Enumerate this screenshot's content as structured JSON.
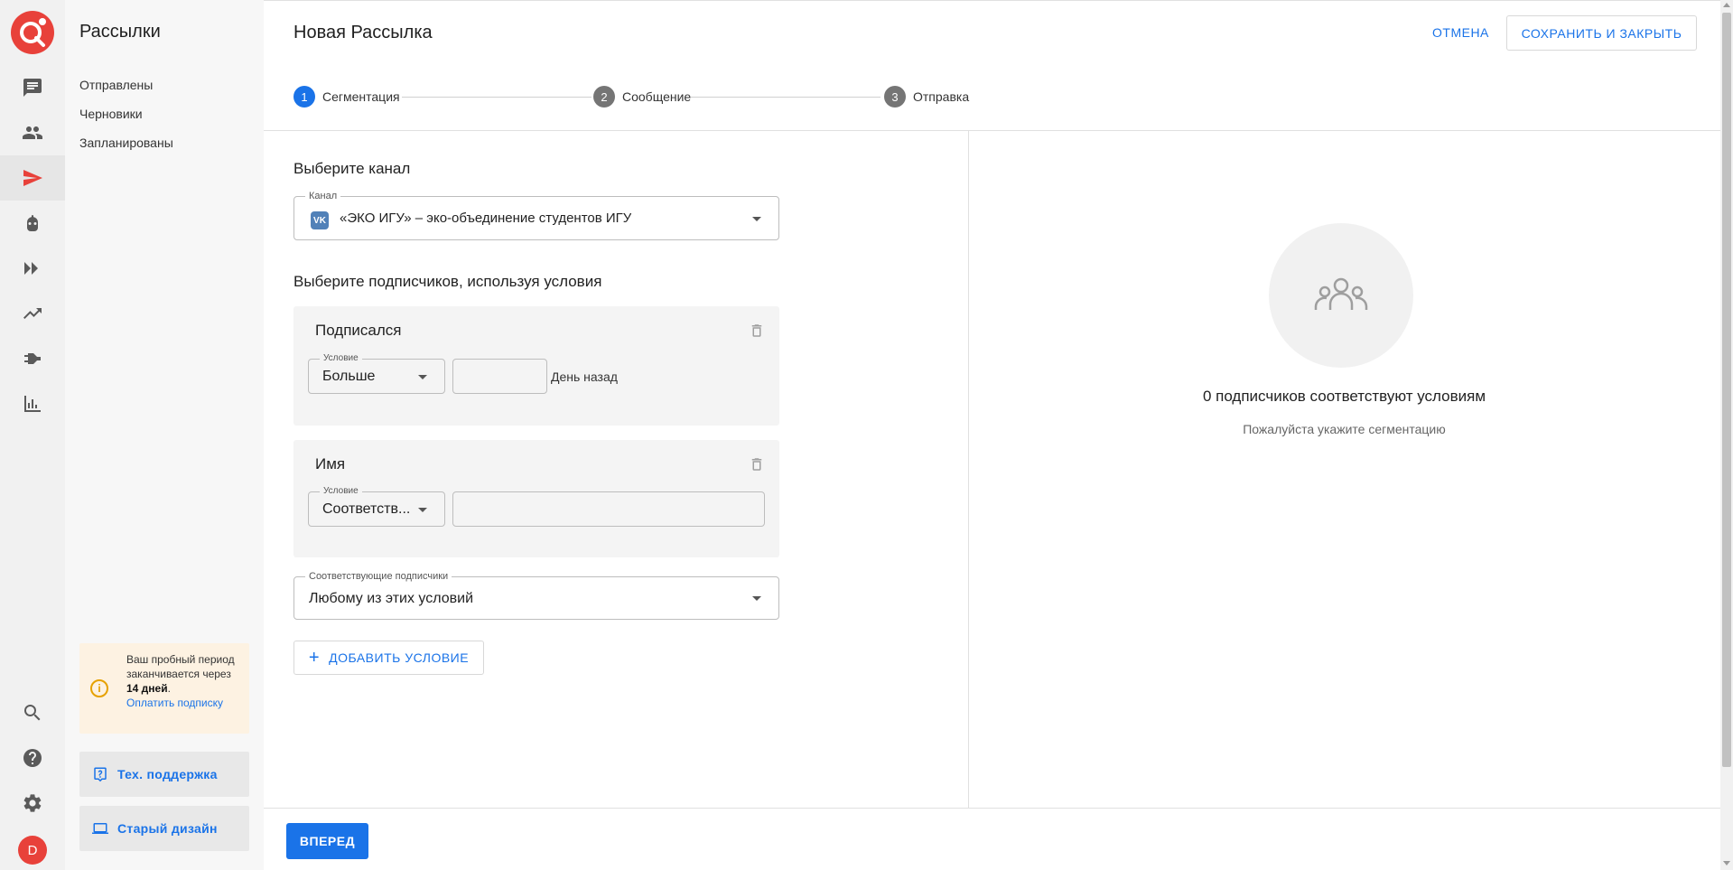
{
  "rail": {
    "items": [
      {
        "icon": "chat-icon",
        "active": false
      },
      {
        "icon": "people-icon",
        "active": false
      },
      {
        "icon": "send-icon",
        "active": true
      },
      {
        "icon": "bot-icon",
        "active": false
      },
      {
        "icon": "chains-icon",
        "active": false
      },
      {
        "icon": "trending-icon",
        "active": false
      },
      {
        "icon": "plug-icon",
        "active": false
      },
      {
        "icon": "stats-icon",
        "active": false
      }
    ],
    "bottom_icons": [
      "search-icon",
      "help-icon",
      "gear-icon"
    ],
    "avatar_letter": "D"
  },
  "sidebar": {
    "title": "Рассылки",
    "links": [
      "Отправлены",
      "Черновики",
      "Запланированы"
    ],
    "trial": {
      "text_before": "Ваш пробный период заканчивается через ",
      "days": "14 дней",
      "text_after": ".",
      "link": "Оплатить подписку"
    },
    "support_label": "Тех. поддержка",
    "old_design_label": "Старый дизайн"
  },
  "header": {
    "title": "Новая Рассылка",
    "cancel": "ОТМЕНА",
    "save_close": "СОХРАНИТЬ И ЗАКРЫТЬ"
  },
  "stepper": {
    "steps": [
      {
        "num": "1",
        "label": "Сегментация",
        "active": true
      },
      {
        "num": "2",
        "label": "Сообщение",
        "active": false
      },
      {
        "num": "3",
        "label": "Отправка",
        "active": false
      }
    ]
  },
  "form": {
    "channel_section_title": "Выберите канал",
    "channel_label": "Канал",
    "channel_icon_text": "VK",
    "channel_value": "«ЭКО ИГУ» – эко-объединение студентов ИГУ",
    "subscribers_section_title": "Выберите подписчиков, используя условия",
    "conditions": [
      {
        "title": "Подписался",
        "condition_label": "Условие",
        "condition_value": "Больше",
        "input_value": "",
        "suffix": "День назад"
      },
      {
        "title": "Имя",
        "condition_label": "Условие",
        "condition_value": "Соответств...",
        "input_value": ""
      }
    ],
    "match_label": "Соответствующие подписчики",
    "match_value": "Любому из этих условий",
    "add_condition": "ДОБАВИТЬ УСЛОВИЕ"
  },
  "preview": {
    "title": "0 подписчиков соответствуют условиям",
    "subtitle": "Пожалуйста укажите сегментацию"
  },
  "footer": {
    "next": "ВПЕРЕД"
  },
  "colors": {
    "accent": "#1a73e8",
    "brand": "#e8413a",
    "trial_bg": "#fdf2e2"
  }
}
